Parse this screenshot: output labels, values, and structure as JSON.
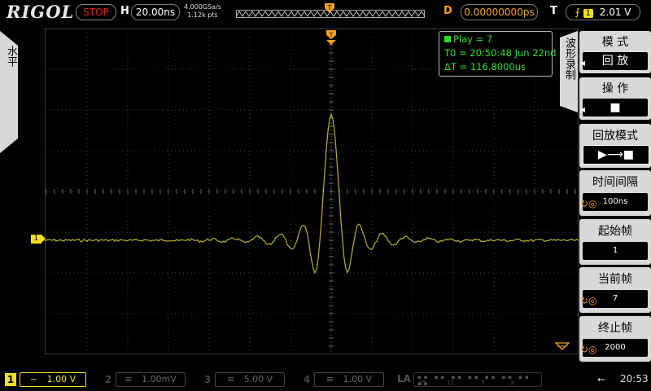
{
  "header": {
    "logo": "RIGOL",
    "run_state": "STOP",
    "h_label": "H",
    "timebase": "20.00ns",
    "sample_rate": "4.000GSa/s",
    "memory_depth": "1.12k pts",
    "d_label": "D",
    "delay": "0.00000000ps",
    "t_label": "T",
    "trigger_source": "1",
    "trigger_level": "2.01 V"
  },
  "left_tab": {
    "label": "水平"
  },
  "info": {
    "play": "Play = 7",
    "t0": "T0 = 20:50:48 Jun 22nd",
    "delta_t": "ΔT = 116.8000us"
  },
  "menu": {
    "title": "波形录制",
    "items": [
      {
        "label": "模  式",
        "value": "回  放"
      },
      {
        "label": "操  作",
        "value": "■"
      },
      {
        "label": "回放模式",
        "value": "▶⟶■"
      },
      {
        "label": "时间间隔",
        "value": "100ns"
      },
      {
        "label": "起始帧",
        "value": "1"
      },
      {
        "label": "当前帧",
        "value": "7"
      },
      {
        "label": "终止帧",
        "value": "2000"
      }
    ]
  },
  "channels": [
    {
      "num": "1",
      "coupling": "~",
      "scale": "1.00 V",
      "color": "#f0e020",
      "active": true
    },
    {
      "num": "2",
      "coupling": "≡",
      "scale": "1.00mV",
      "color": "#40a0f0",
      "active": false
    },
    {
      "num": "3",
      "coupling": "≡",
      "scale": "5.00 V",
      "color": "#f040c0",
      "active": false
    },
    {
      "num": "4",
      "coupling": "≡",
      "scale": "1.00 V",
      "color": "#3060f0",
      "active": false
    }
  ],
  "la": {
    "label": "LA",
    "ticks": [
      "15",
      "11",
      "7",
      "3"
    ]
  },
  "status": {
    "time": "20:53"
  },
  "ch1_marker": "1",
  "colors": {
    "ch1": "#f0e020",
    "trigger": "#f0a020",
    "info": "#28e028",
    "stop": "#e02020"
  },
  "waveform": {
    "note_units": "divisions",
    "baseline_div": 0,
    "peak_div": 3.1,
    "trough_div": -0.45
  }
}
